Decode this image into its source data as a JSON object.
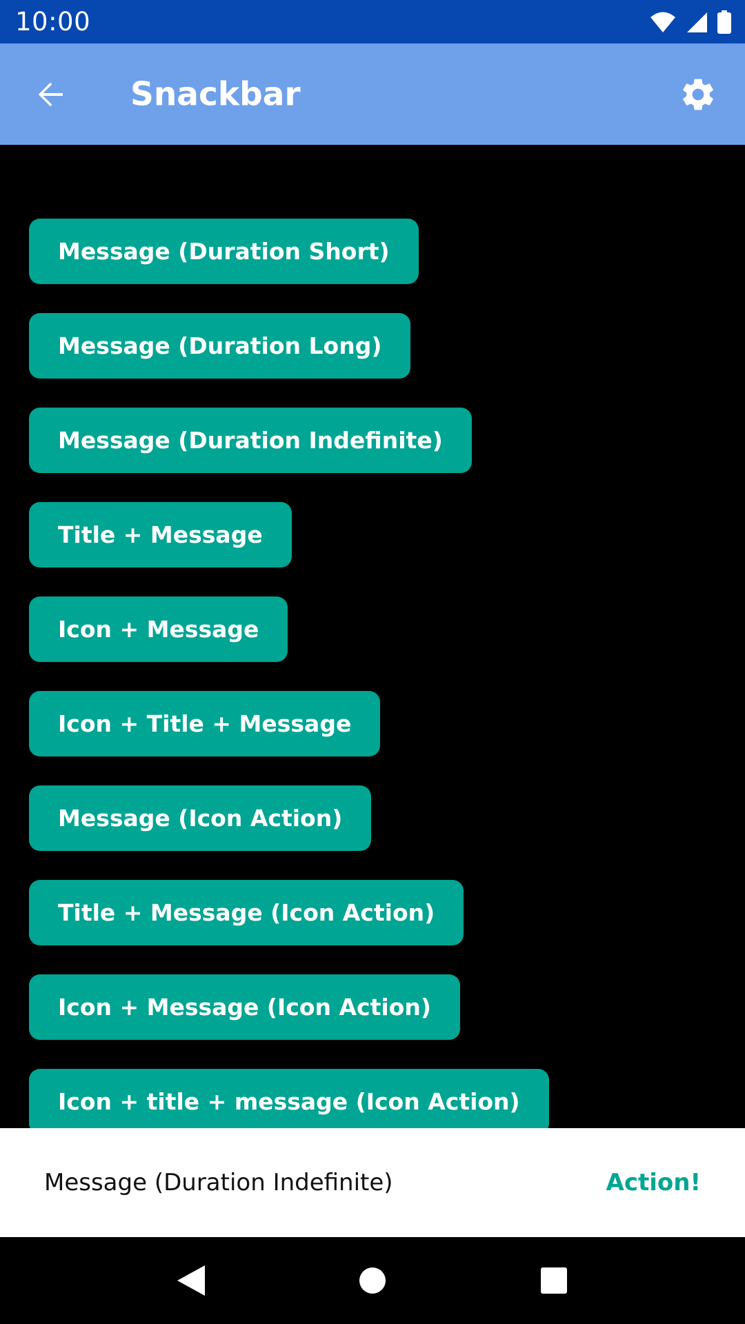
{
  "status_bar": {
    "time": "10:00"
  },
  "app_bar": {
    "title": "Snackbar",
    "back_icon": "arrow-back-icon",
    "settings_icon": "gear-icon"
  },
  "buttons": [
    {
      "label": "Message (Duration Short)"
    },
    {
      "label": "Message (Duration Long)"
    },
    {
      "label": "Message (Duration Indefinite)"
    },
    {
      "label": "Title + Message"
    },
    {
      "label": "Icon + Message"
    },
    {
      "label": "Icon + Title + Message"
    },
    {
      "label": "Message (Icon Action)"
    },
    {
      "label": "Title + Message (Icon Action)"
    },
    {
      "label": "Icon + Message (Icon Action)"
    },
    {
      "label": "Icon + title + message (Icon Action)"
    }
  ],
  "snackbar": {
    "message": "Message (Duration Indefinite)",
    "action_label": "Action!"
  },
  "colors": {
    "status_bar": "#0747b0",
    "app_bar": "#6fa0ea",
    "button": "#00a593",
    "accent": "#00a593",
    "background": "#000000"
  }
}
